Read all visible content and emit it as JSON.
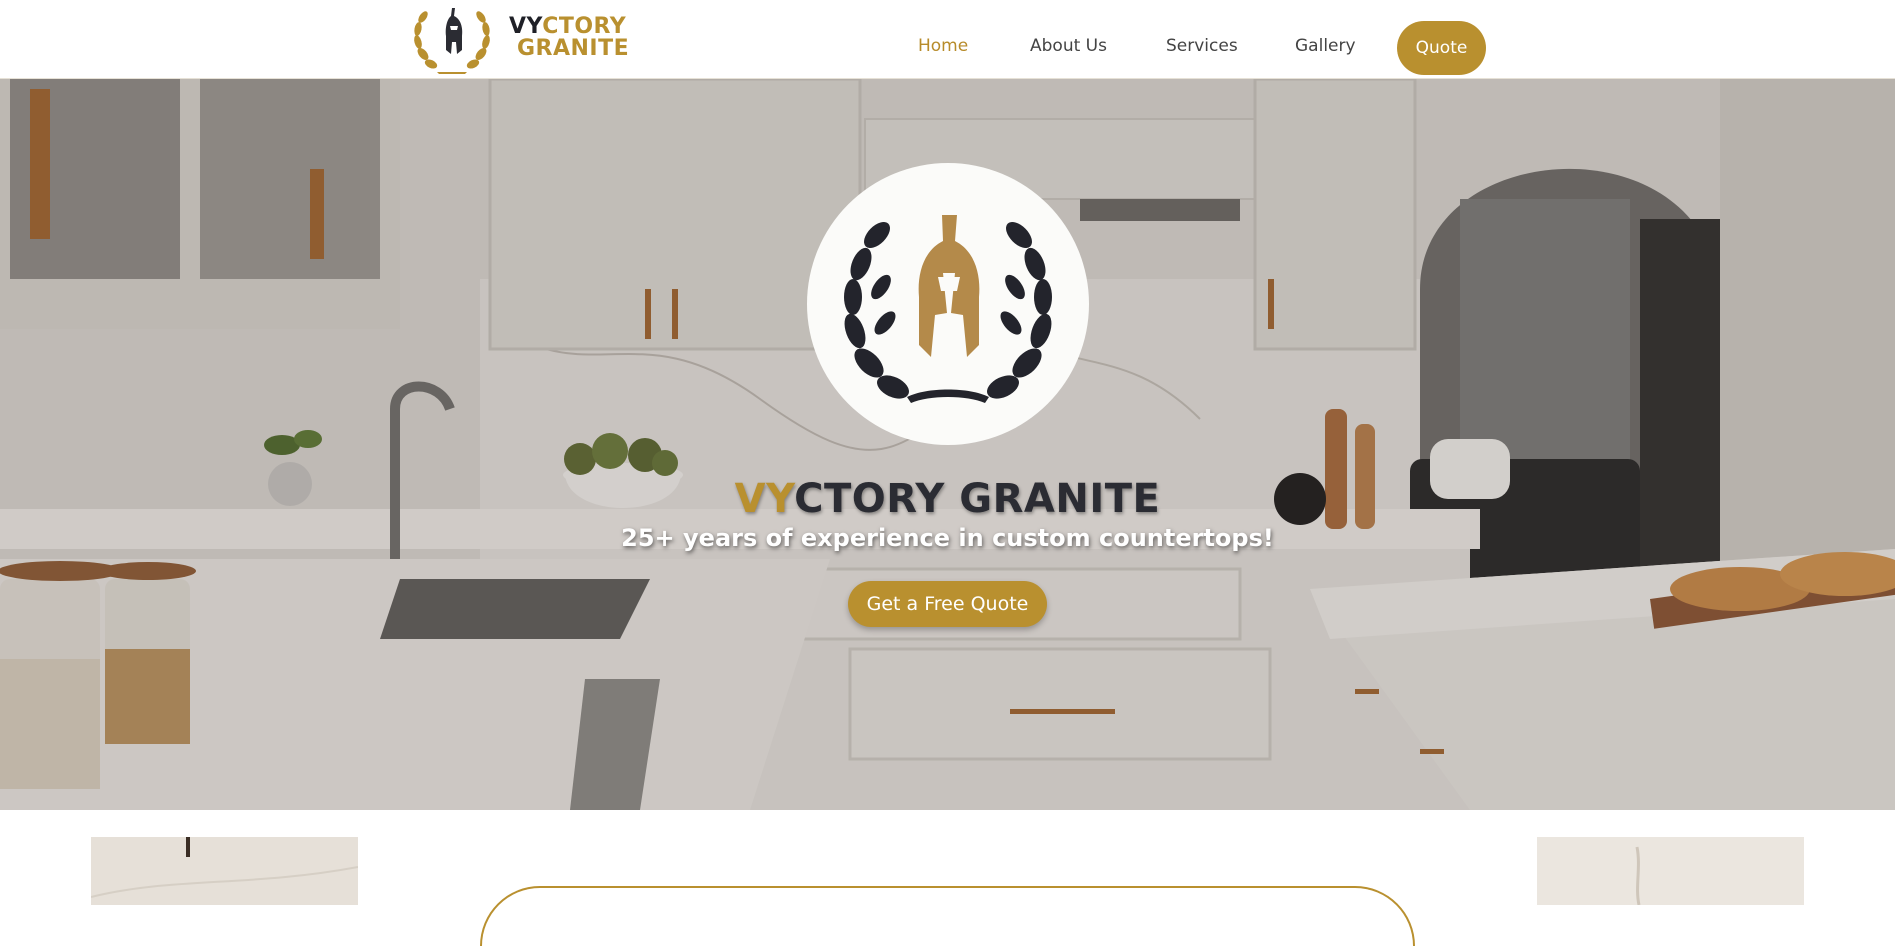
{
  "header": {
    "logo_icon": "spartan-helmet-laurel-icon",
    "brand_line1_dark": "VY",
    "brand_line1_gold": "CTORY",
    "brand_line2": "GRANITE",
    "nav": [
      {
        "label": "Home",
        "active": true
      },
      {
        "label": "About Us",
        "active": false
      },
      {
        "label": "Services",
        "active": false
      },
      {
        "label": "Gallery",
        "active": false
      }
    ],
    "quote_label": "Quote"
  },
  "hero": {
    "emblem_icon": "spartan-helmet-laurel-icon",
    "title_accent": "VY",
    "title_rest": "CTORY GRANITE",
    "subtitle": "25+ years of experience in custom countertops!",
    "cta_label": "Get a Free Quote",
    "background": "kitchen-photo"
  },
  "colors": {
    "accent": "#b9902f",
    "dark": "#2b2c33",
    "nav_text": "#444444"
  }
}
